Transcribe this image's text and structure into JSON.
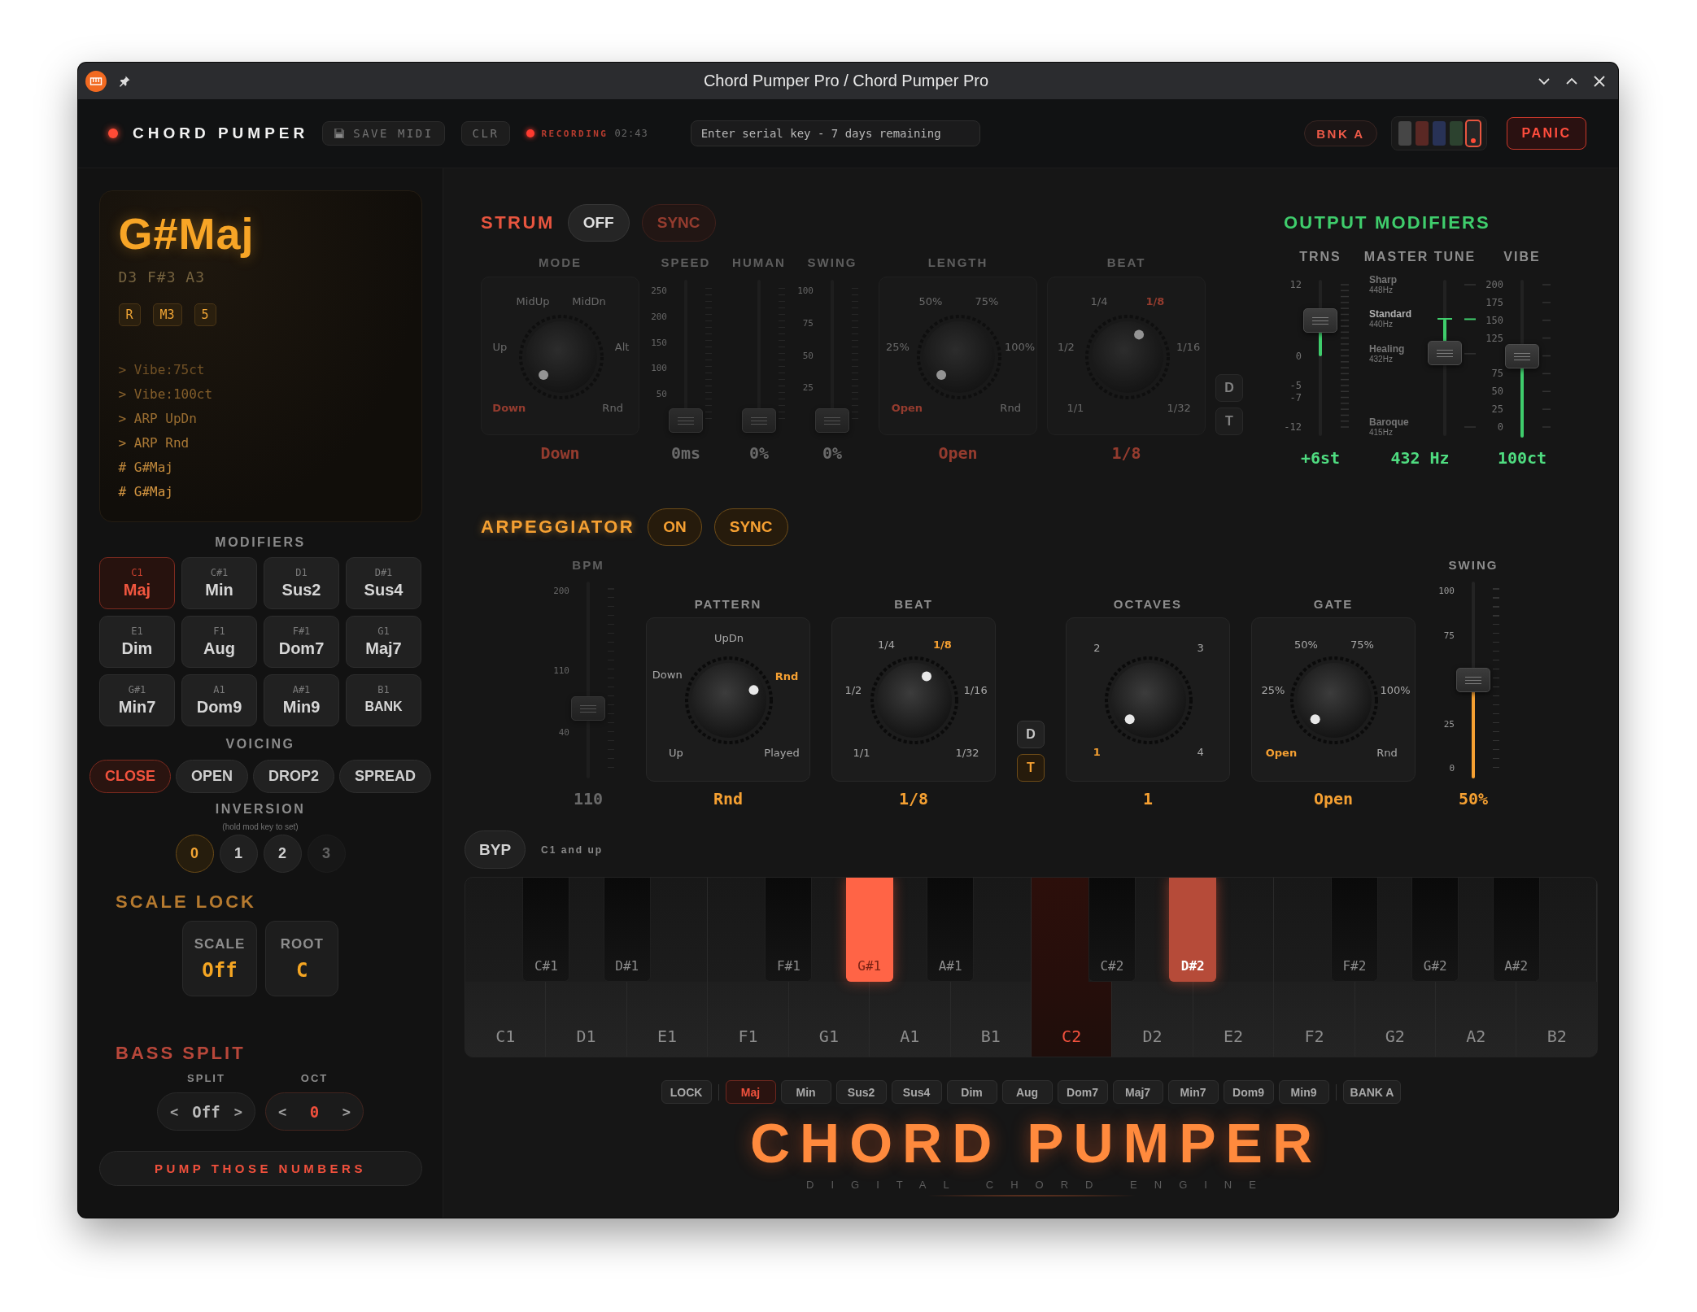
{
  "window": {
    "title": "Chord Pumper Pro / Chord Pumper Pro"
  },
  "header": {
    "brand": "CHORD PUMPER",
    "buttons": [
      {
        "kind": "save",
        "label": "SAVE MIDI"
      },
      {
        "kind": "clear",
        "label": "CLR"
      }
    ],
    "recording": {
      "on": true,
      "label": "RECORDING",
      "time": "02:43"
    },
    "serial": {
      "placeholder": "Enter serial key - 7 days remaining"
    },
    "bank": "BNK A",
    "swatches": [
      {
        "color": "#464646",
        "selected": false
      },
      {
        "color": "#5a2824",
        "selected": false
      },
      {
        "color": "#283256",
        "selected": false
      },
      {
        "color": "#2c422f",
        "selected": false
      },
      {
        "color": "#262626",
        "selected": true
      }
    ],
    "panic": "PANIC"
  },
  "display": {
    "chord": "G#Maj",
    "notes": "D3 F#3 A3",
    "intervals": [
      "R",
      "M3",
      "5"
    ],
    "log": [
      "> Vibe:75ct",
      "> Vibe:100ct",
      "> ARP UpDn",
      "> ARP Rnd",
      "# G#Maj",
      "# G#Maj"
    ]
  },
  "modifiers": {
    "title": "MODIFIERS",
    "items": [
      {
        "kind": "chord",
        "note": "C1",
        "label": "Maj",
        "selected": true
      },
      {
        "kind": "chord",
        "note": "C#1",
        "label": "Min",
        "selected": false
      },
      {
        "kind": "chord",
        "note": "D1",
        "label": "Sus2",
        "selected": false
      },
      {
        "kind": "chord",
        "note": "D#1",
        "label": "Sus4",
        "selected": false
      },
      {
        "kind": "chord",
        "note": "E1",
        "label": "Dim",
        "selected": false
      },
      {
        "kind": "chord",
        "note": "F1",
        "label": "Aug",
        "selected": false
      },
      {
        "kind": "chord",
        "note": "F#1",
        "label": "Dom7",
        "selected": false
      },
      {
        "kind": "chord",
        "note": "G1",
        "label": "Maj7",
        "selected": false
      },
      {
        "kind": "chord",
        "note": "G#1",
        "label": "Min7",
        "selected": false
      },
      {
        "kind": "chord",
        "note": "A1",
        "label": "Dom9",
        "selected": false
      },
      {
        "kind": "chord",
        "note": "A#1",
        "label": "Min9",
        "selected": false
      },
      {
        "kind": "bank",
        "note": "B1",
        "label": "BANK",
        "selected": false
      }
    ]
  },
  "voicing": {
    "title": "VOICING",
    "options": [
      {
        "label": "CLOSE",
        "selected": true
      },
      {
        "label": "OPEN",
        "selected": false
      },
      {
        "label": "DROP2",
        "selected": false
      },
      {
        "label": "SPREAD",
        "selected": false
      }
    ]
  },
  "inversion": {
    "title": "INVERSION",
    "hint": "(hold mod key to set)",
    "options": [
      {
        "label": "0",
        "selected": true,
        "disabled": false
      },
      {
        "label": "1",
        "selected": false,
        "disabled": false
      },
      {
        "label": "2",
        "selected": false,
        "disabled": false
      },
      {
        "label": "3",
        "selected": false,
        "disabled": true
      }
    ]
  },
  "scale_lock": {
    "title": "SCALE LOCK",
    "fields": [
      {
        "label": "SCALE",
        "value": "Off"
      },
      {
        "label": "ROOT",
        "value": "C"
      }
    ]
  },
  "bass_split": {
    "title": "BASS SPLIT",
    "steppers": [
      {
        "label": "SPLIT",
        "dec": "<",
        "value": "Off",
        "inc": ">",
        "active": false
      },
      {
        "label": "OCT",
        "dec": "<",
        "value": "0",
        "inc": ">",
        "active": true
      }
    ]
  },
  "pump_button": "PUMP THOSE NUMBERS",
  "strum": {
    "title": "STRUM",
    "on": false,
    "toggle": "OFF",
    "sync": {
      "label": "SYNC",
      "on": true
    },
    "controls": [
      {
        "kind": "knob",
        "label": "MODE",
        "options": [
          {
            "label": "MidUp",
            "selected": false
          },
          {
            "label": "MidDn",
            "selected": false
          },
          {
            "label": "Up",
            "selected": false
          },
          {
            "label": "Alt",
            "selected": false
          },
          {
            "label": "Down",
            "selected": true
          },
          {
            "label": "Rnd",
            "selected": false
          }
        ],
        "value": "Down"
      },
      {
        "kind": "slider",
        "label": "SPEED",
        "ticks": [
          "250",
          "200",
          "150",
          "100",
          "50"
        ],
        "level": 0,
        "value": "0ms"
      },
      {
        "kind": "slider",
        "label": "HUMAN",
        "level": 0,
        "value": "0%"
      },
      {
        "kind": "slider",
        "label": "SWING",
        "ticks": [
          "100",
          "75",
          "50",
          "25"
        ],
        "level": 0,
        "value": "0%"
      },
      {
        "kind": "knob",
        "label": "LENGTH",
        "options": [
          {
            "label": "50%",
            "selected": false
          },
          {
            "label": "75%",
            "selected": false
          },
          {
            "label": "25%",
            "selected": false
          },
          {
            "label": "100%",
            "selected": false
          },
          {
            "label": "Open",
            "selected": true
          },
          {
            "label": "Rnd",
            "selected": false
          }
        ],
        "value": "Open"
      },
      {
        "kind": "knob",
        "label": "BEAT",
        "options": [
          {
            "label": "1/4",
            "selected": false
          },
          {
            "label": "1/8",
            "selected": true
          },
          {
            "label": "1/2",
            "selected": false
          },
          {
            "label": "1/16",
            "selected": false
          },
          {
            "label": "1/1",
            "selected": false
          },
          {
            "label": "1/32",
            "selected": false
          }
        ],
        "value": "1/8"
      },
      {
        "kind": "toggles",
        "options": [
          {
            "label": "D",
            "selected": false
          },
          {
            "label": "T",
            "selected": false
          }
        ]
      }
    ]
  },
  "output": {
    "title": "OUTPUT MODIFIERS",
    "sliders": [
      {
        "kind": "bipolar",
        "label": "TRNS",
        "ticks": [
          "12",
          "0",
          "-5",
          "-7",
          "-12"
        ],
        "level": 0.75,
        "value": "+6st"
      },
      {
        "kind": "presets",
        "label": "MASTER TUNE",
        "presets": [
          {
            "name": "Sharp",
            "freq": "448Hz",
            "default": false
          },
          {
            "name": "Standard",
            "freq": "440Hz",
            "default": true
          },
          {
            "name": "Healing",
            "freq": "432Hz",
            "default": false
          },
          {
            "name": "Baroque",
            "freq": "415Hz",
            "default": false
          }
        ],
        "level": 0.52,
        "value": "432 Hz"
      },
      {
        "kind": "unipolar",
        "label": "VIBE",
        "ticks": [
          "200",
          "175",
          "150",
          "125",
          "75",
          "50",
          "25",
          "0"
        ],
        "level": 0.5,
        "value": "100ct"
      }
    ]
  },
  "arp": {
    "title": "ARPEGGIATOR",
    "on": true,
    "toggle": "ON",
    "sync": {
      "label": "SYNC",
      "on": true
    },
    "controls": [
      {
        "kind": "slider",
        "label": "BPM",
        "disabled": true,
        "ticks": [
          "200",
          "110",
          "40"
        ],
        "level": 0.34,
        "value": "110"
      },
      {
        "kind": "knob",
        "label": "PATTERN",
        "options": [
          {
            "label": "UpDn",
            "selected": false
          },
          {
            "label": "Down",
            "selected": false
          },
          {
            "label": "Rnd",
            "selected": true
          },
          {
            "label": "Up",
            "selected": false
          },
          {
            "label": "Played",
            "selected": false
          }
        ],
        "value": "Rnd"
      },
      {
        "kind": "knob",
        "label": "BEAT",
        "options": [
          {
            "label": "1/4",
            "selected": false
          },
          {
            "label": "1/8",
            "selected": true
          },
          {
            "label": "1/2",
            "selected": false
          },
          {
            "label": "1/16",
            "selected": false
          },
          {
            "label": "1/1",
            "selected": false
          },
          {
            "label": "1/32",
            "selected": false
          }
        ],
        "value": "1/8"
      },
      {
        "kind": "toggles",
        "options": [
          {
            "label": "D",
            "selected": false
          },
          {
            "label": "T",
            "selected": true
          }
        ]
      },
      {
        "kind": "knob",
        "label": "OCTAVES",
        "options": [
          {
            "label": "2",
            "selected": false
          },
          {
            "label": "3",
            "selected": false
          },
          {
            "label": "1",
            "selected": true
          },
          {
            "label": "4",
            "selected": false
          }
        ],
        "value": "1"
      },
      {
        "kind": "knob",
        "label": "GATE",
        "options": [
          {
            "label": "50%",
            "selected": false
          },
          {
            "label": "75%",
            "selected": false
          },
          {
            "label": "25%",
            "selected": false
          },
          {
            "label": "100%",
            "selected": false
          },
          {
            "label": "Open",
            "selected": true
          },
          {
            "label": "Rnd",
            "selected": false
          }
        ],
        "value": "Open"
      },
      {
        "kind": "slider",
        "label": "SWING",
        "disabled": false,
        "ticks": [
          "100",
          "75",
          "25",
          "0"
        ],
        "level": 0.5,
        "value": "50%"
      }
    ]
  },
  "keyboard": {
    "bypass": "BYP",
    "range": "C1 and up",
    "keys": [
      {
        "kind": "white",
        "label": "C1",
        "selected": false,
        "pressed": false
      },
      {
        "kind": "black",
        "label": "C#1",
        "selected": false,
        "pressed": false
      },
      {
        "kind": "white",
        "label": "D1",
        "selected": false,
        "pressed": false
      },
      {
        "kind": "black",
        "label": "D#1",
        "selected": false,
        "pressed": false
      },
      {
        "kind": "white",
        "label": "E1",
        "selected": false,
        "pressed": false
      },
      {
        "kind": "white",
        "label": "F1",
        "selected": false,
        "pressed": false
      },
      {
        "kind": "black",
        "label": "F#1",
        "selected": false,
        "pressed": false
      },
      {
        "kind": "white",
        "label": "G1",
        "selected": false,
        "pressed": false
      },
      {
        "kind": "black",
        "label": "G#1",
        "selected": true,
        "pressed": true
      },
      {
        "kind": "white",
        "label": "A1",
        "selected": false,
        "pressed": false
      },
      {
        "kind": "black",
        "label": "A#1",
        "selected": false,
        "pressed": false
      },
      {
        "kind": "white",
        "label": "B1",
        "selected": false,
        "pressed": false
      },
      {
        "kind": "white",
        "label": "C2",
        "selected": true,
        "pressed": false
      },
      {
        "kind": "black",
        "label": "C#2",
        "selected": false,
        "pressed": false
      },
      {
        "kind": "white",
        "label": "D2",
        "selected": false,
        "pressed": false
      },
      {
        "kind": "black",
        "label": "D#2",
        "selected": true,
        "pressed": false
      },
      {
        "kind": "white",
        "label": "E2",
        "selected": false,
        "pressed": false
      },
      {
        "kind": "white",
        "label": "F2",
        "selected": false,
        "pressed": false
      },
      {
        "kind": "black",
        "label": "F#2",
        "selected": false,
        "pressed": false
      },
      {
        "kind": "white",
        "label": "G2",
        "selected": false,
        "pressed": false
      },
      {
        "kind": "black",
        "label": "G#2",
        "selected": false,
        "pressed": false
      },
      {
        "kind": "white",
        "label": "A2",
        "selected": false,
        "pressed": false
      },
      {
        "kind": "black",
        "label": "A#2",
        "selected": false,
        "pressed": false
      },
      {
        "kind": "white",
        "label": "B2",
        "selected": false,
        "pressed": false
      }
    ]
  },
  "chord_strip": {
    "lock": "LOCK",
    "chords": [
      {
        "label": "Maj",
        "selected": true
      },
      {
        "label": "Min",
        "selected": false
      },
      {
        "label": "Sus2",
        "selected": false
      },
      {
        "label": "Sus4",
        "selected": false
      },
      {
        "label": "Dim",
        "selected": false
      },
      {
        "label": "Aug",
        "selected": false
      },
      {
        "label": "Dom7",
        "selected": false
      },
      {
        "label": "Maj7",
        "selected": false
      },
      {
        "label": "Min7",
        "selected": false
      },
      {
        "label": "Dom9",
        "selected": false
      },
      {
        "label": "Min9",
        "selected": false
      }
    ],
    "bank": "BANK A"
  },
  "logo": {
    "title": "CHORD PUMPER",
    "subtitle": "DIGITAL CHORD ENGINE"
  }
}
